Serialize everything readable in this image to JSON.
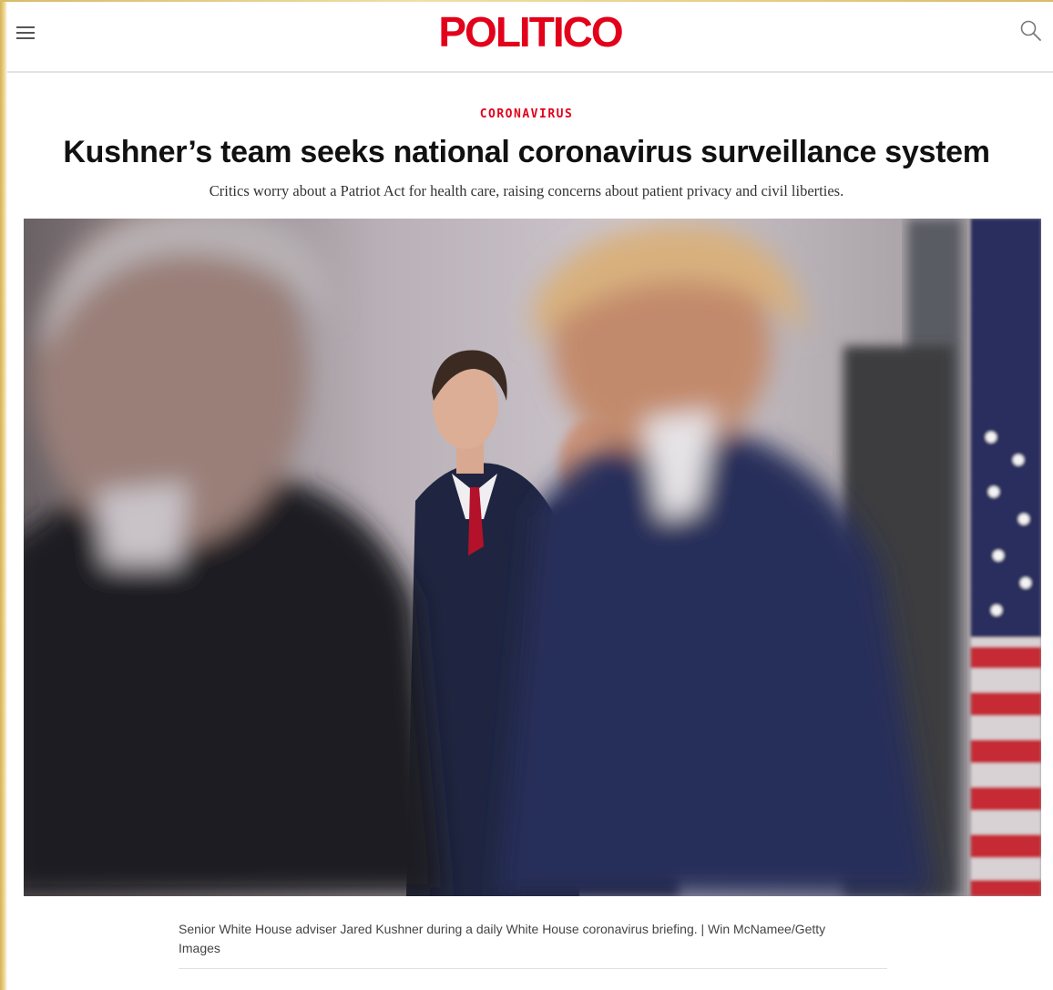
{
  "header": {
    "menu_icon": "hamburger-menu-icon",
    "logo_text": "POLITICO",
    "search_icon": "search-icon",
    "brand_color": "#e2001a"
  },
  "article": {
    "kicker": "CORONAVIRUS",
    "headline": "Kushner’s team seeks national coronavirus surveillance system",
    "dek": "Critics worry about a Patriot Act for health care, raising concerns about patient privacy and civil liberties.",
    "photo": {
      "caption": "Senior White House adviser Jared Kushner during a daily White House coronavirus briefing. | Win McNamee/Getty Images"
    }
  }
}
